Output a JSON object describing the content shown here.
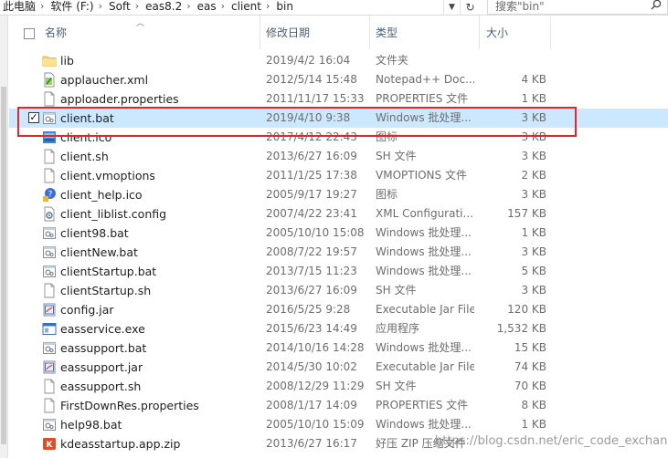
{
  "address_bar": {
    "crumbs": [
      "此电脑",
      "软件 (F:)",
      "Soft",
      "eas8.2",
      "eas",
      "client",
      "bin"
    ],
    "separator": "›"
  },
  "search": {
    "placeholder": "搜索\"bin\""
  },
  "columns": {
    "name": "名称",
    "date": "修改日期",
    "type": "类型",
    "size": "大小"
  },
  "files": [
    {
      "name": "lib",
      "date": "2019/4/2 16:04",
      "type": "文件夹",
      "size": "",
      "icon": "folder-icon"
    },
    {
      "name": "applaucher.xml",
      "date": "2012/5/14 15:48",
      "type": "Notepad++ Doc...",
      "size": "4 KB",
      "icon": "notepad-file-icon"
    },
    {
      "name": "apploader.properties",
      "date": "2011/11/17 15:33",
      "type": "PROPERTIES 文件",
      "size": "1 KB",
      "icon": "blank-file-icon"
    },
    {
      "name": "client.bat",
      "date": "2019/4/10 9:38",
      "type": "Windows 批处理...",
      "size": "3 KB",
      "icon": "batch-file-icon",
      "selected": true
    },
    {
      "name": "client.ico",
      "date": "2017/4/12 22:43",
      "type": "图标",
      "size": "3 KB",
      "icon": "image-file-icon"
    },
    {
      "name": "client.sh",
      "date": "2013/6/27 16:09",
      "type": "SH 文件",
      "size": "3 KB",
      "icon": "blank-file-icon"
    },
    {
      "name": "client.vmoptions",
      "date": "2011/1/25 17:38",
      "type": "VMOPTIONS 文件",
      "size": "2 KB",
      "icon": "blank-file-icon"
    },
    {
      "name": "client_help.ico",
      "date": "2005/9/17 19:27",
      "type": "图标",
      "size": "3 KB",
      "icon": "help-icon"
    },
    {
      "name": "client_liblist.config",
      "date": "2007/4/22 23:41",
      "type": "XML Configurati...",
      "size": "157 KB",
      "icon": "config-file-icon"
    },
    {
      "name": "client98.bat",
      "date": "2005/10/10 15:08",
      "type": "Windows 批处理...",
      "size": "1 KB",
      "icon": "batch-file-icon"
    },
    {
      "name": "clientNew.bat",
      "date": "2008/7/22 19:57",
      "type": "Windows 批处理...",
      "size": "3 KB",
      "icon": "batch-file-icon"
    },
    {
      "name": "clientStartup.bat",
      "date": "2013/7/15 11:23",
      "type": "Windows 批处理...",
      "size": "5 KB",
      "icon": "batch-file-icon"
    },
    {
      "name": "clientStartup.sh",
      "date": "2013/6/27 16:09",
      "type": "SH 文件",
      "size": "3 KB",
      "icon": "blank-file-icon"
    },
    {
      "name": "config.jar",
      "date": "2016/5/25 9:28",
      "type": "Executable Jar File",
      "size": "120 KB",
      "icon": "jar-file-icon"
    },
    {
      "name": "easservice.exe",
      "date": "2015/6/23 14:49",
      "type": "应用程序",
      "size": "1,532 KB",
      "icon": "exe-file-icon"
    },
    {
      "name": "eassupport.bat",
      "date": "2014/10/16 14:28",
      "type": "Windows 批处理...",
      "size": "15 KB",
      "icon": "batch-file-icon"
    },
    {
      "name": "eassupport.jar",
      "date": "2014/5/30 10:02",
      "type": "Executable Jar File",
      "size": "74 KB",
      "icon": "jar-file-icon"
    },
    {
      "name": "eassupport.sh",
      "date": "2008/12/29 11:29",
      "type": "SH 文件",
      "size": "70 KB",
      "icon": "blank-file-icon"
    },
    {
      "name": "FirstDownRes.properties",
      "date": "2008/1/17 14:09",
      "type": "PROPERTIES 文件",
      "size": "8 KB",
      "icon": "blank-file-icon"
    },
    {
      "name": "help98.bat",
      "date": "2005/10/10 15:09",
      "type": "Windows 批处理...",
      "size": "1 KB",
      "icon": "batch-file-icon"
    },
    {
      "name": "kdeasstartup.app.zip",
      "date": "2013/6/27 16:17",
      "type": "好压 ZIP 压缩文件",
      "size": "",
      "icon": "zip-file-icon"
    }
  ],
  "watermark": "https://blog.csdn.net/eric_code_exchange",
  "colors": {
    "selection": "#cce8ff",
    "highlight": "#e3262b",
    "header_text": "#4c607a"
  }
}
